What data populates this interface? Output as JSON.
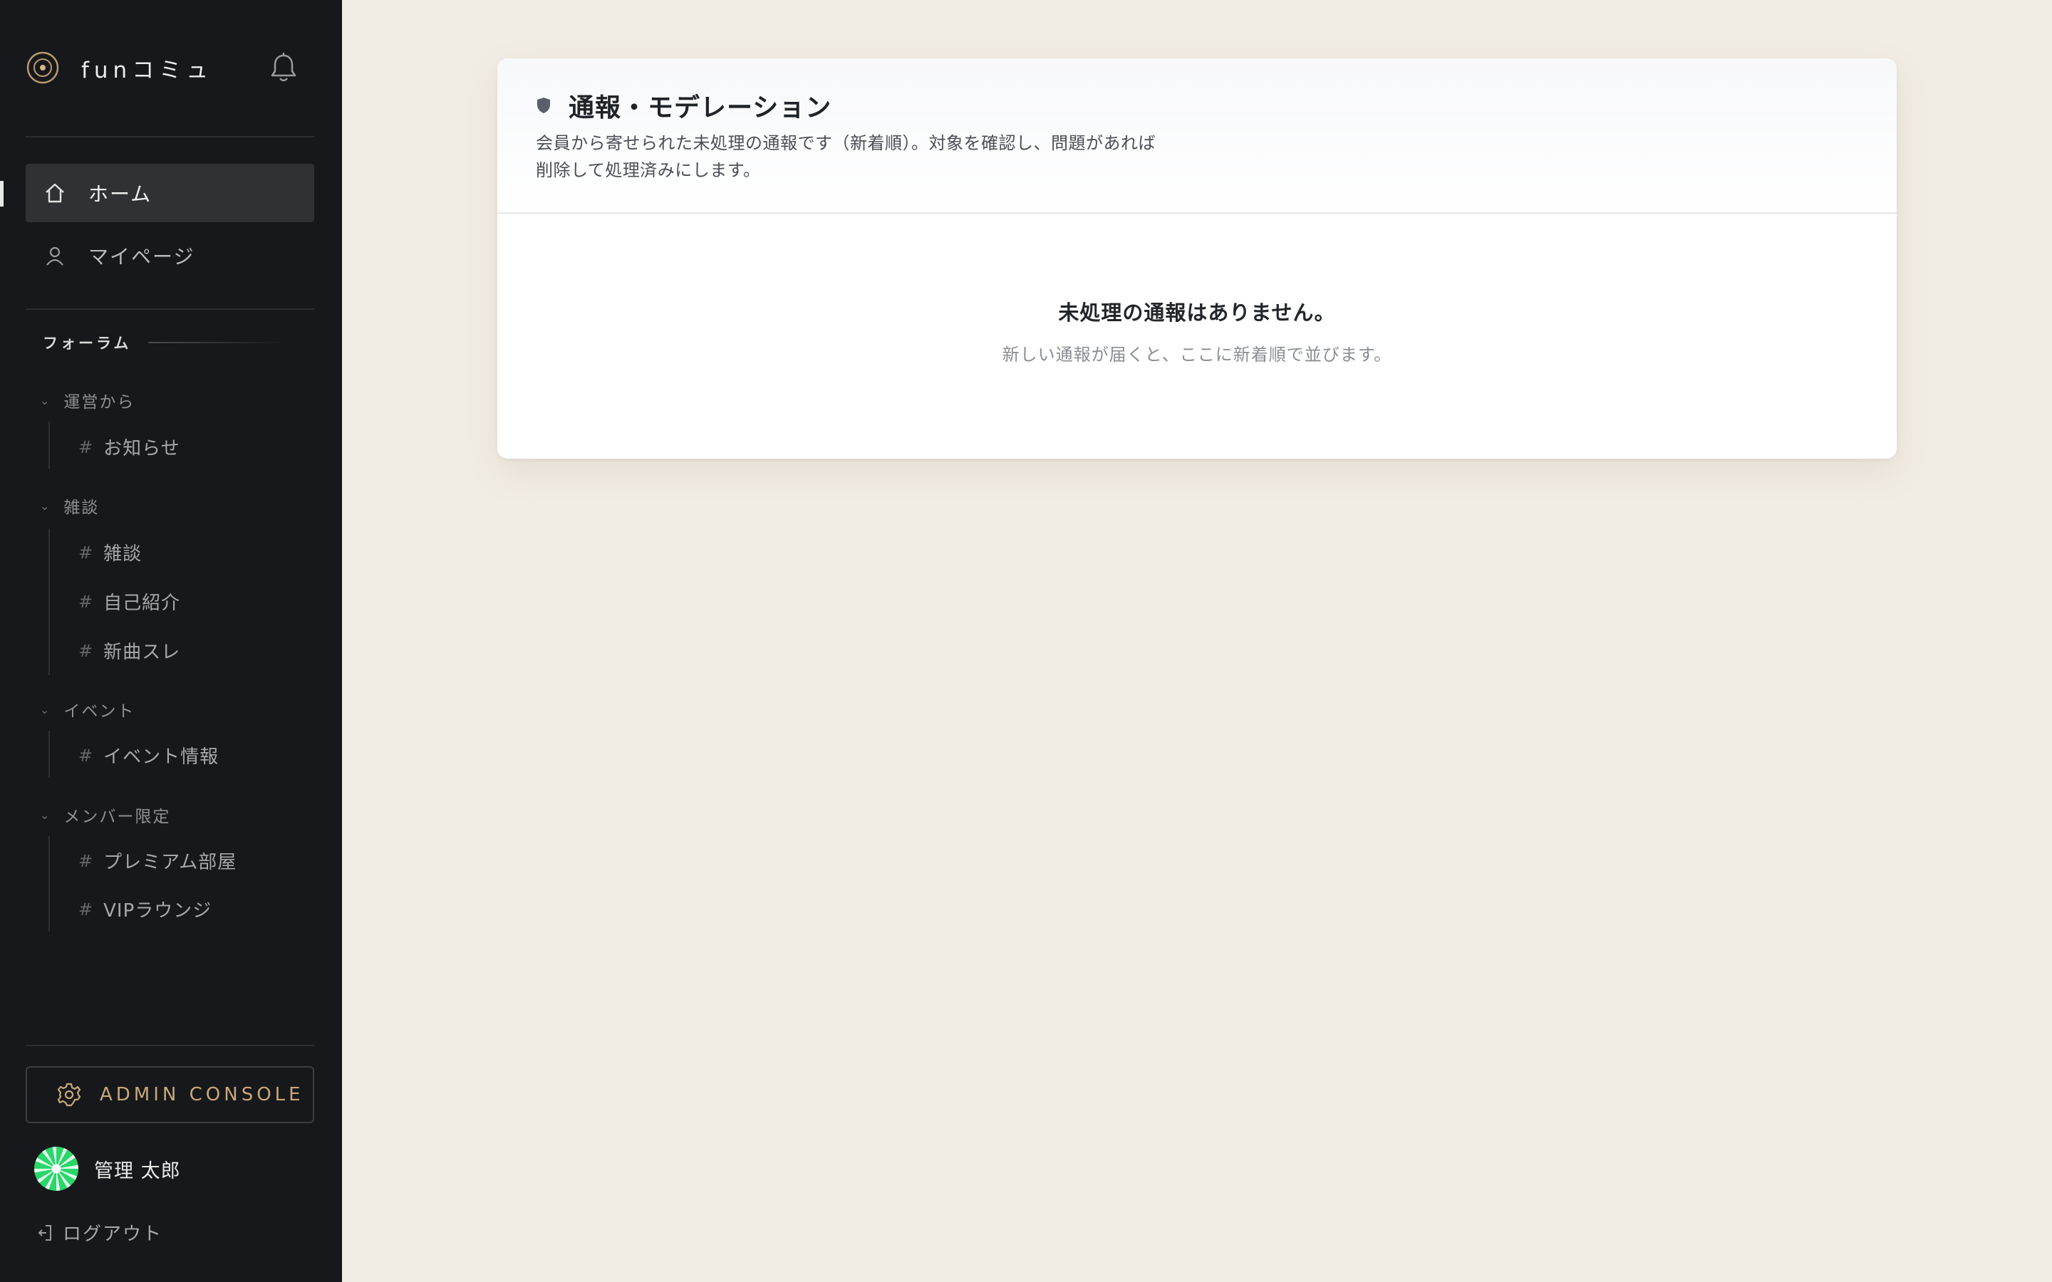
{
  "app": {
    "name": "funコミュ"
  },
  "nav": [
    {
      "label": "ホーム",
      "icon": "home-icon",
      "active": true
    },
    {
      "label": "マイページ",
      "icon": "user-icon",
      "active": false
    }
  ],
  "forum": {
    "section_label": "フォーラム",
    "groups": [
      {
        "label": "運営から",
        "channels": [
          "お知らせ"
        ]
      },
      {
        "label": "雑談",
        "channels": [
          "雑談",
          "自己紹介",
          "新曲スレ"
        ]
      },
      {
        "label": "イベント",
        "channels": [
          "イベント情報"
        ]
      },
      {
        "label": "メンバー限定",
        "channels": [
          "プレミアム部屋",
          "VIPラウンジ"
        ]
      }
    ]
  },
  "admin": {
    "label": "ADMIN CONSOLE"
  },
  "user": {
    "name": "管理 太郎"
  },
  "logout": {
    "label": "ログアウト"
  },
  "moderation": {
    "title": "通報・モデレーション",
    "description": "会員から寄せられた未処理の通報です（新着順）。対象を確認し、問題があれば削除して処理済みにします。",
    "empty_title": "未処理の通報はありません。",
    "empty_subtitle": "新しい通報が届くと、ここに新着順で並びます。"
  },
  "colors": {
    "sidebar_bg": "#17181b",
    "page_bg": "#f2ede4",
    "accent_gold": "#c8a878"
  }
}
